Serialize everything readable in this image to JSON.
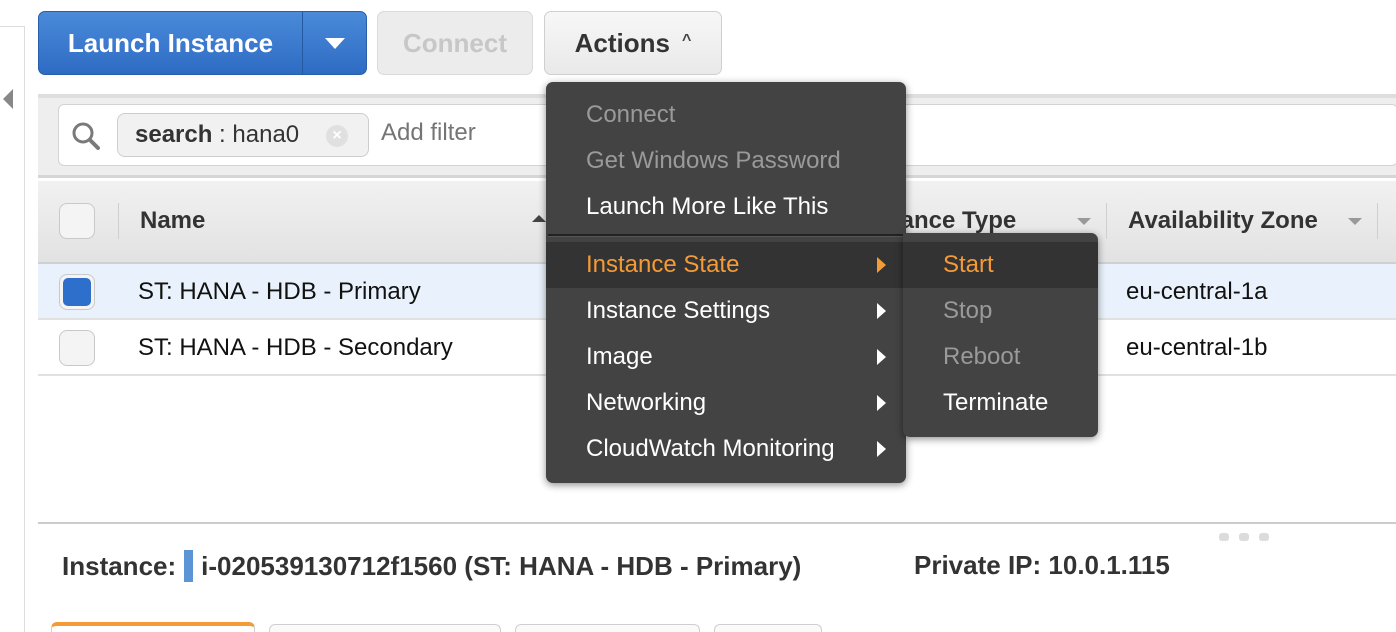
{
  "toolbar": {
    "launch_label": "Launch Instance",
    "connect_label": "Connect",
    "actions_label": "Actions",
    "actions_caret": "^"
  },
  "filter": {
    "chip_key": "search",
    "chip_sep": " : ",
    "chip_value": "hana0",
    "chip_close": "×",
    "placeholder": "Add filter"
  },
  "table": {
    "columns": [
      {
        "label": "Name",
        "sort": "ascending"
      },
      {
        "label": "Instance Type",
        "sort": "none"
      },
      {
        "label": "Availability Zone",
        "sort": "none"
      }
    ],
    "rows": [
      {
        "selected": true,
        "name": "ST: HANA - HDB - Primary",
        "zone": "eu-central-1a"
      },
      {
        "selected": false,
        "name": "ST: HANA - HDB - Secondary",
        "zone": "eu-central-1b"
      }
    ]
  },
  "actions_menu": {
    "items": [
      {
        "label": "Connect",
        "state": "disabled",
        "submenu": false
      },
      {
        "label": "Get Windows Password",
        "state": "disabled",
        "submenu": false
      },
      {
        "label": "Launch More Like This",
        "state": "enabled",
        "submenu": false
      },
      {
        "label": "Instance State",
        "state": "active",
        "submenu": true
      },
      {
        "label": "Instance Settings",
        "state": "enabled",
        "submenu": true
      },
      {
        "label": "Image",
        "state": "enabled",
        "submenu": true
      },
      {
        "label": "Networking",
        "state": "enabled",
        "submenu": true
      },
      {
        "label": "CloudWatch Monitoring",
        "state": "enabled",
        "submenu": true
      }
    ],
    "instance_state_submenu": [
      {
        "label": "Start",
        "state": "active"
      },
      {
        "label": "Stop",
        "state": "disabled"
      },
      {
        "label": "Reboot",
        "state": "disabled"
      },
      {
        "label": "Terminate",
        "state": "enabled"
      }
    ]
  },
  "details": {
    "instance_label": "Instance:",
    "instance_value": "i-020539130712f1560 (ST: HANA - HDB - Primary)",
    "private_ip": "Private IP: 10.0.1.115"
  },
  "colors": {
    "primary_blue": "#2e6cc4",
    "accent_orange": "#f49b37",
    "menu_bg": "#434343",
    "selected_row": "#e9f2fc"
  }
}
